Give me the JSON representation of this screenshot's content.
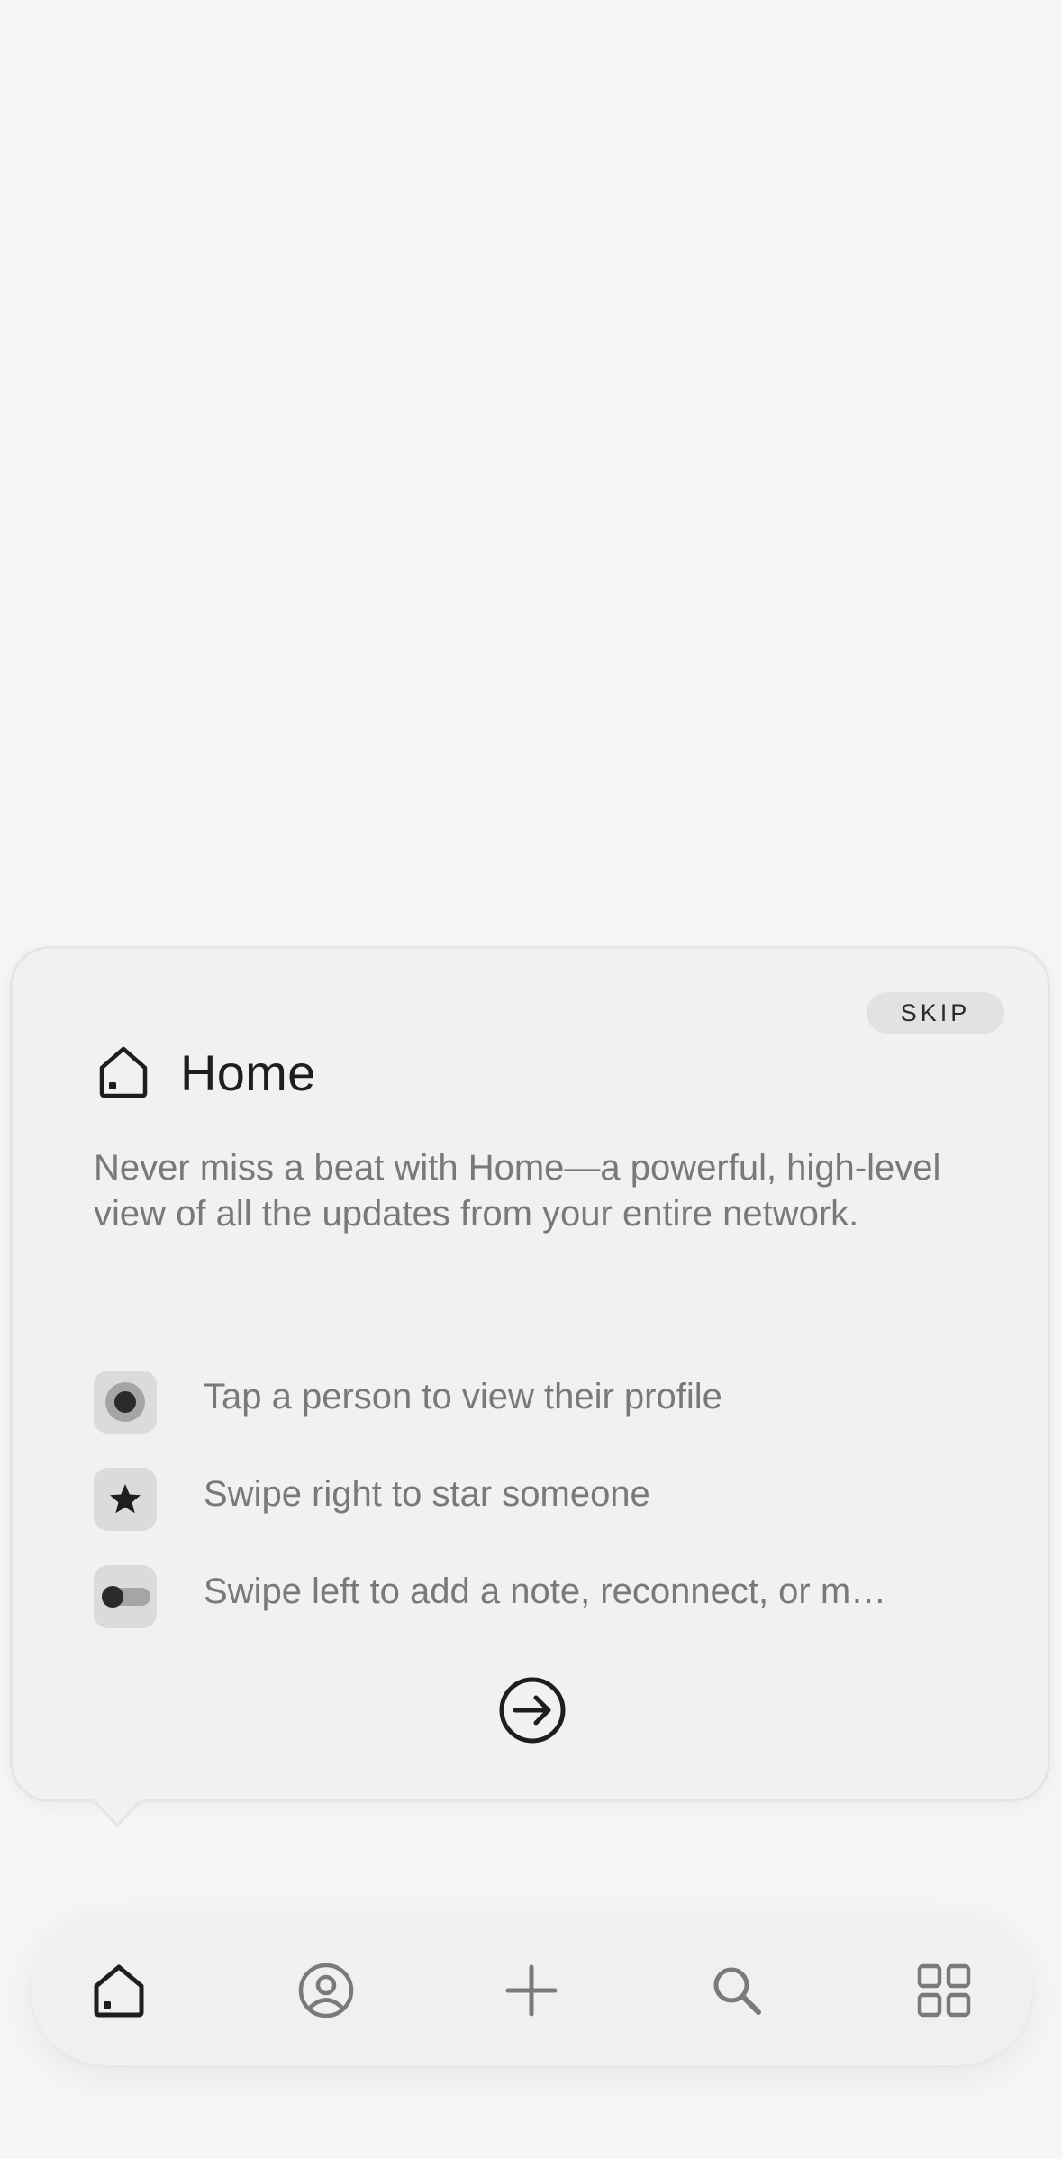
{
  "coachmark": {
    "skip_label": "SKIP",
    "title": "Home",
    "title_icon": "home-icon",
    "description": "Never miss a beat with Home—a powerful, high-level view of all the updates from your entire network.",
    "tips": [
      {
        "icon": "tap-dot-icon",
        "label": "Tap a person to view their profile"
      },
      {
        "icon": "star-icon",
        "label": "Swipe right to star someone"
      },
      {
        "icon": "toggle-icon",
        "label": "Swipe left to add a note, reconnect, or m…"
      }
    ],
    "next_icon": "arrow-right-circle-icon"
  },
  "tab_bar": {
    "tabs": [
      {
        "icon": "home-icon",
        "selected": true
      },
      {
        "icon": "profile-icon",
        "selected": false
      },
      {
        "icon": "plus-icon",
        "selected": false
      },
      {
        "icon": "search-icon",
        "selected": false
      },
      {
        "icon": "grid-icon",
        "selected": false
      }
    ]
  },
  "colors": {
    "background": "#f7f6f5",
    "card": "#f2f1f0",
    "text_primary": "#1e1e1e",
    "text_secondary": "#7a7978",
    "icon_inactive": "#7b7a79"
  }
}
